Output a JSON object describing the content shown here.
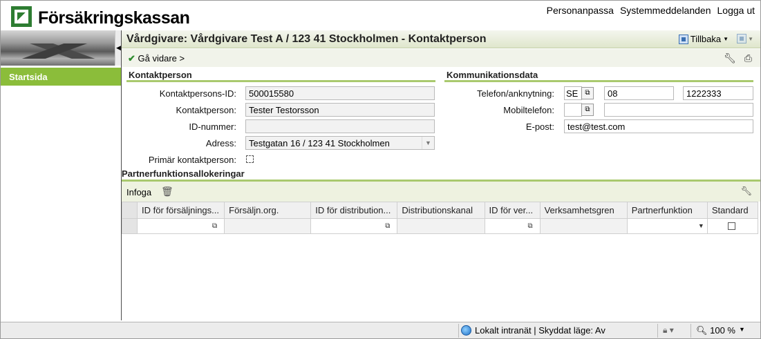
{
  "header": {
    "logo_text": "Försäkringskassan",
    "links": [
      "Personanpassa",
      "Systemmeddelanden",
      "Logga ut"
    ]
  },
  "nav": {
    "start_label": "Startsida"
  },
  "titlebar": {
    "title": "Vårdgivare: Vårdgivare Test A / 123 41 Stockholmen - Kontaktperson",
    "back_label": "Tillbaka"
  },
  "toolbar": {
    "go_on_label": "Gå vidare >"
  },
  "contact": {
    "section_title": "Kontaktperson",
    "id_label": "Kontaktpersons-ID:",
    "id_value": "500015580",
    "name_label": "Kontaktperson:",
    "name_value": "Tester Testorsson",
    "idnr_label": "ID-nummer:",
    "idnr_value": "",
    "address_label": "Adress:",
    "address_value": "Testgatan 16 / 123 41 Stockholmen",
    "primary_label": "Primär kontaktperson:",
    "primary_checked": false
  },
  "comm": {
    "section_title": "Kommunikationsdata",
    "phone_label": "Telefon/anknytning:",
    "phone_country": "SE",
    "phone_area": "08",
    "phone_number": "1222333",
    "mobile_label": "Mobiltelefon:",
    "mobile_country": "",
    "mobile_number": "",
    "email_label": "E-post:",
    "email_value": "test@test.com"
  },
  "partner": {
    "section_title": "Partnerfunktionsallokeringar",
    "insert_label": "Infoga",
    "columns": [
      "ID för försäljnings...",
      "Försäljn.org.",
      "ID för distribution...",
      "Distributionskanal",
      "ID för ver...",
      "Verksamhetsgren",
      "Partnerfunktion",
      "Standard"
    ]
  },
  "statusbar": {
    "zone_text": "Lokalt intranät | Skyddat läge: Av",
    "zoom_text": "100 %"
  },
  "colors": {
    "accent_green": "#8bbd3a",
    "rule_green": "#a9c96e"
  }
}
